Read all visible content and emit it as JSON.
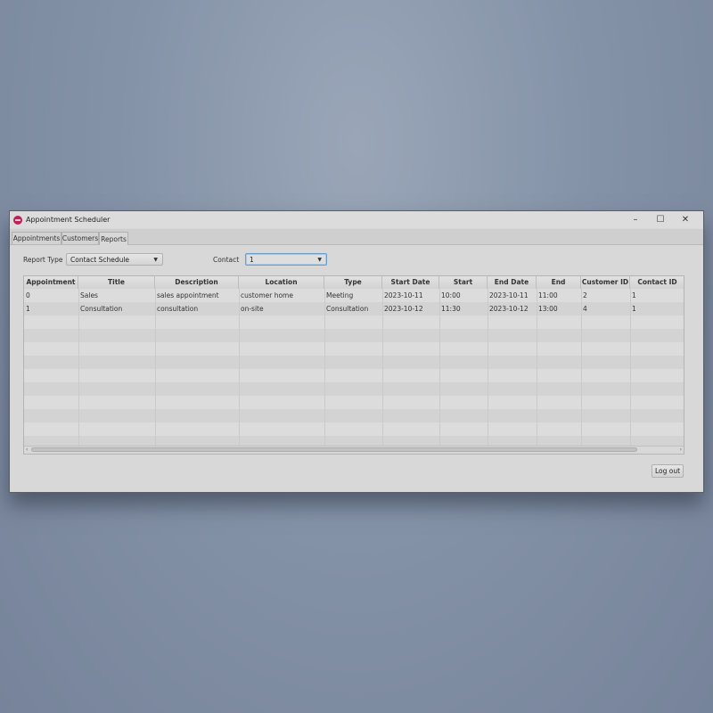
{
  "window": {
    "title": "Appointment Scheduler",
    "controls": {
      "minimize": "–",
      "maximize": "☐",
      "close": "✕"
    }
  },
  "tabs": [
    {
      "label": "Appointments",
      "active": false
    },
    {
      "label": "Customers",
      "active": false
    },
    {
      "label": "Reports",
      "active": true
    }
  ],
  "filters": {
    "report_type_label": "Report Type",
    "report_type_value": "Contact Schedule",
    "contact_label": "Contact",
    "contact_value": "1"
  },
  "table": {
    "columns": [
      "Appointment ID",
      "Title",
      "Description",
      "Location",
      "Type",
      "Start Date",
      "Start",
      "End Date",
      "End",
      "Customer ID",
      "Contact ID"
    ],
    "rows": [
      [
        "0",
        "Sales",
        "sales appointment",
        "customer home",
        "Meeting",
        "2023-10-11",
        "10:00",
        "2023-10-11",
        "11:00",
        "2",
        "1"
      ],
      [
        "1",
        "Consultation",
        "consultation",
        "on-site",
        "Consultation",
        "2023-10-12",
        "11:30",
        "2023-10-12",
        "13:00",
        "4",
        "1"
      ]
    ]
  },
  "actions": {
    "logout_label": "Log out"
  },
  "colors": {
    "window_bg": "#d8d8d8",
    "focus_accent": "#6a9ecb",
    "app_icon": "#c0205a",
    "desktop_bg": "#8593a8"
  }
}
